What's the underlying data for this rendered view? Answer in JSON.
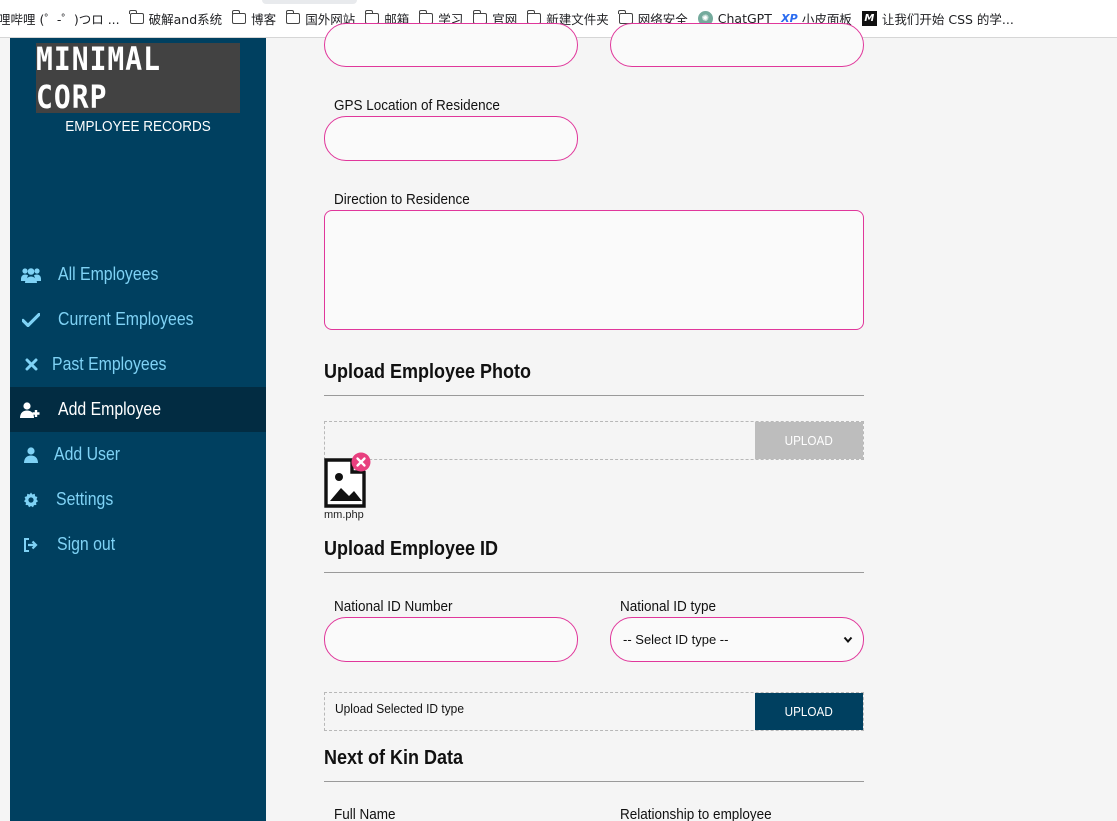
{
  "bookmarks": [
    {
      "label": "哩哔哩 (゜-゜)つロ ...",
      "icon": "none"
    },
    {
      "label": "破解and系统",
      "icon": "folder-icon"
    },
    {
      "label": "博客",
      "icon": "folder-icon"
    },
    {
      "label": "国外网站",
      "icon": "folder-icon"
    },
    {
      "label": "邮箱",
      "icon": "folder-icon"
    },
    {
      "label": "学习",
      "icon": "folder-icon"
    },
    {
      "label": "官网",
      "icon": "folder-icon"
    },
    {
      "label": "新建文件夹",
      "icon": "folder-icon"
    },
    {
      "label": "网络安全",
      "icon": "folder-icon"
    },
    {
      "label": "ChatGPT",
      "icon": "chatgpt-icon"
    },
    {
      "label": "小皮面板",
      "icon": "xp-icon"
    },
    {
      "label": "让我们开始 CSS 的学...",
      "icon": "m-icon"
    }
  ],
  "sidebar": {
    "logo": "MINIMAL CORP",
    "subtitle": "EMPLOYEE RECORDS",
    "items": [
      {
        "label": "All Employees",
        "icon": "users-icon",
        "active": false
      },
      {
        "label": "Current Employees",
        "icon": "check-icon",
        "active": false
      },
      {
        "label": "Past Employees",
        "icon": "close-icon",
        "active": false
      },
      {
        "label": "Add Employee",
        "icon": "user-plus-icon",
        "active": true
      },
      {
        "label": "Add User",
        "icon": "user-icon",
        "active": false
      },
      {
        "label": "Settings",
        "icon": "gear-icon",
        "active": false
      },
      {
        "label": "Sign out",
        "icon": "sign-out-icon",
        "active": false
      }
    ]
  },
  "form": {
    "gps_label": "GPS Location of Residence",
    "gps_value": "",
    "direction_label": "Direction to Residence",
    "direction_value": "",
    "photo_heading": "Upload Employee Photo",
    "photo_upload_button": "UPLOAD",
    "photo_file_name": "mm.php",
    "id_heading": "Upload Employee ID",
    "national_id_label": "National ID Number",
    "national_id_value": "",
    "id_type_label": "National ID type",
    "id_type_selected": "-- Select ID type --",
    "id_upload_text": "Upload Selected ID type",
    "id_upload_button": "UPLOAD",
    "kin_heading": "Next of Kin Data",
    "kin_full_name_label": "Full Name",
    "kin_relationship_label": "Relationship to employee"
  },
  "colors": {
    "sidebar_bg": "#004060",
    "sidebar_active_bg": "#022c42",
    "nav_text": "#7fd2f5",
    "input_border": "#e0379b",
    "upload_disabled": "#bdbdbd",
    "upload_active": "#004060",
    "remove_badge": "#e8407f"
  }
}
